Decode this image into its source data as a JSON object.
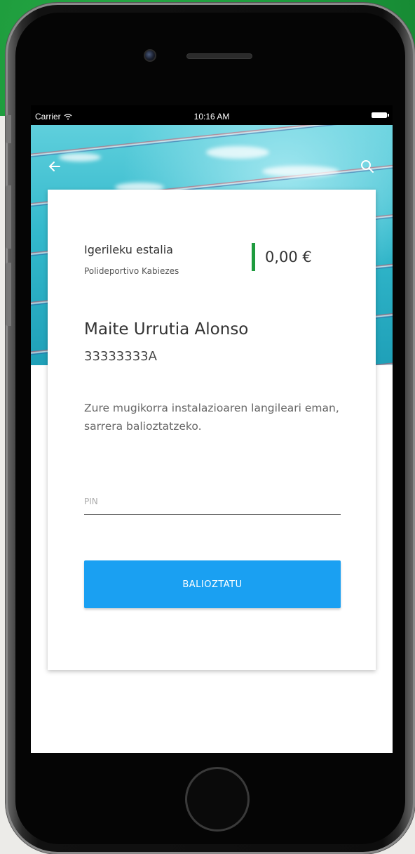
{
  "status_bar": {
    "carrier": "Carrier",
    "time": "10:16 AM"
  },
  "header": {
    "back_icon": "arrow-left-icon",
    "search_icon": "search-icon"
  },
  "booking": {
    "facility_name": "Igerileku estalia",
    "venue": "Polideportivo Kabiezes",
    "price": "0,00 €",
    "price_accent_color": "#1e9b3e"
  },
  "user": {
    "name": "Maite Urrutia Alonso",
    "id_number": "33333333A"
  },
  "instructions": "Zure mugikorra instalazioaren langileari eman, sarrera balioztatzeko.",
  "form": {
    "pin_placeholder": "PIN",
    "submit_label": "BALIOZTATU",
    "submit_color": "#1aa0f2"
  }
}
